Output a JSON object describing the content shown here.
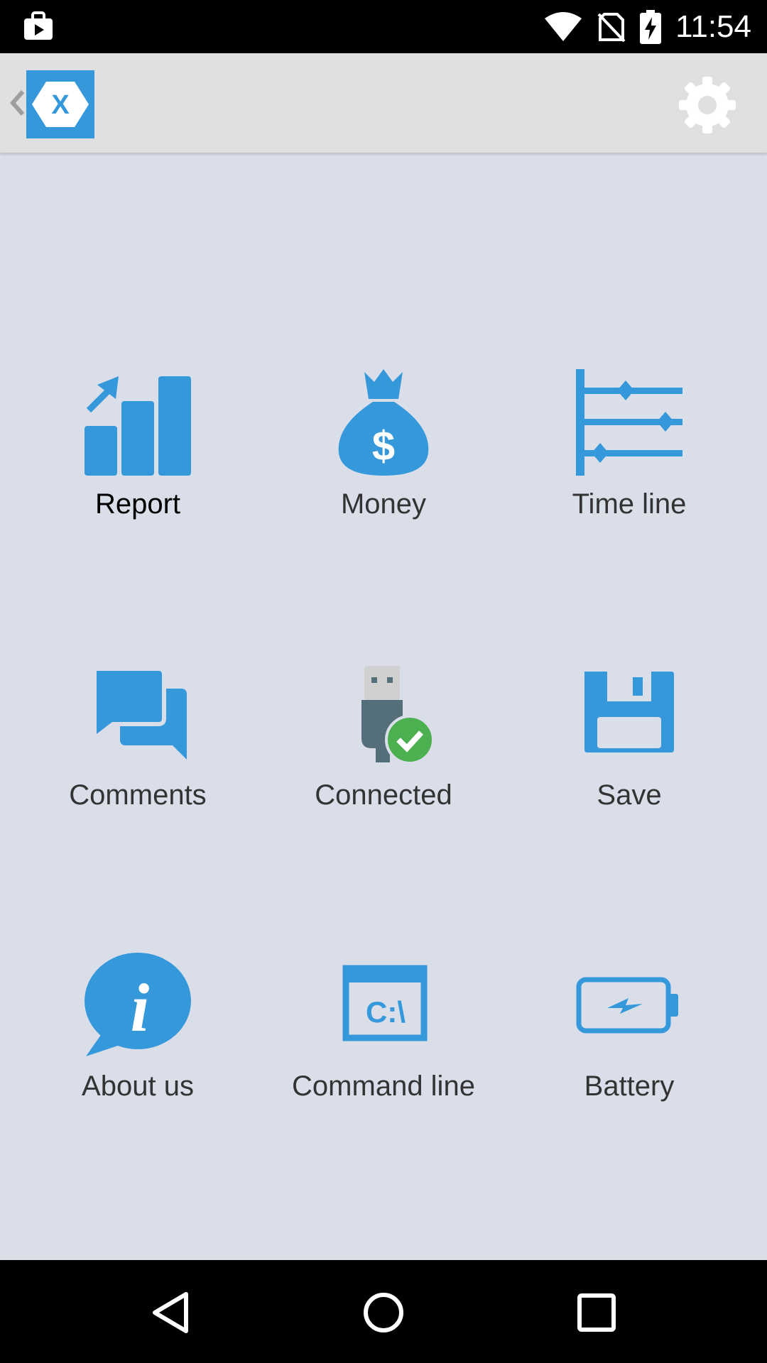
{
  "status_bar": {
    "time": "11:54",
    "icons": [
      "shopping-bag-icon",
      "wifi-icon",
      "no-sim-icon",
      "battery-charging-icon"
    ]
  },
  "app_bar": {
    "logo_letter": "X",
    "icons": [
      "back-chevron-icon",
      "xamarin-logo-icon",
      "settings-gear-icon"
    ]
  },
  "colors": {
    "accent": "#3498db",
    "background": "#dadee8",
    "app_bar": "#e0e0e0",
    "usb_body": "#546e7a",
    "check_green": "#4caf50"
  },
  "menu": {
    "items": [
      {
        "label": "Report",
        "icon": "bar-chart-icon"
      },
      {
        "label": "Money",
        "icon": "money-bag-icon"
      },
      {
        "label": "Time line",
        "icon": "timeline-icon"
      },
      {
        "label": "Comments",
        "icon": "comments-icon"
      },
      {
        "label": "Connected",
        "icon": "usb-connected-icon"
      },
      {
        "label": "Save",
        "icon": "floppy-disk-icon"
      },
      {
        "label": "About us",
        "icon": "info-bubble-icon"
      },
      {
        "label": "Command line",
        "icon": "command-line-icon",
        "glyph": "C:\\"
      },
      {
        "label": "Battery",
        "icon": "battery-icon"
      }
    ]
  },
  "nav_bar": {
    "icons": [
      "back-triangle-icon",
      "home-circle-icon",
      "recents-square-icon"
    ]
  }
}
